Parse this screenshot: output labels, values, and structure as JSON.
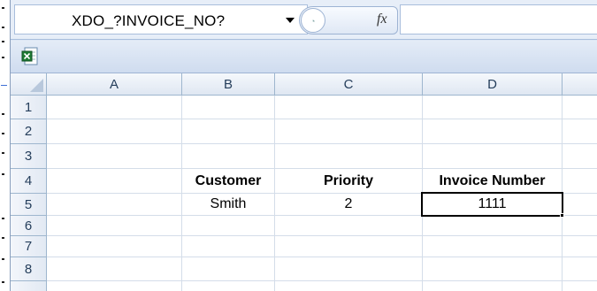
{
  "formula_bar": {
    "name_box_value": "XDO_?INVOICE_NO?",
    "fx_label": "fx",
    "formula_value": ""
  },
  "sheet": {
    "columns": [
      "A",
      "B",
      "C",
      "D"
    ],
    "rows": [
      "1",
      "2",
      "3",
      "4",
      "5",
      "6",
      "7",
      "8"
    ],
    "cells": {
      "B4": "Customer",
      "C4": "Priority",
      "D4": "Invoice Number",
      "B5": "Smith",
      "C5": "2",
      "D5": "1111"
    },
    "active_cell": "D5"
  },
  "icons": {
    "excel_doc": "excel-document-icon",
    "dropdown": "chevron-down-icon",
    "fx": "function-icon"
  },
  "colors": {
    "frame_blue": "#dce6f4",
    "header_text": "#253e5b",
    "gridline": "#d4dde9",
    "excel_green": "#1e7b34"
  }
}
